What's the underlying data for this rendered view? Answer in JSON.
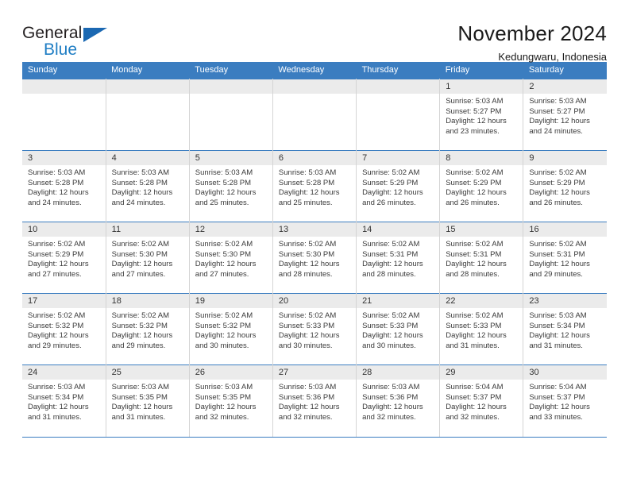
{
  "logo": {
    "word1": "General",
    "word2": "Blue",
    "triangle_color": "#1b68b2",
    "text_color": "#231f20",
    "blue_color": "#1f7ec4"
  },
  "header": {
    "title": "November 2024",
    "location": "Kedungwaru, Indonesia"
  },
  "theme": {
    "header_blue": "#3b7dc0",
    "daynum_band": "#ebebeb",
    "grid_line": "#d4d4d4"
  },
  "day_headers": [
    "Sunday",
    "Monday",
    "Tuesday",
    "Wednesday",
    "Thursday",
    "Friday",
    "Saturday"
  ],
  "weeks": [
    [
      {
        "day": "",
        "empty": true
      },
      {
        "day": "",
        "empty": true
      },
      {
        "day": "",
        "empty": true
      },
      {
        "day": "",
        "empty": true
      },
      {
        "day": "",
        "empty": true
      },
      {
        "day": "1",
        "sunrise": "Sunrise: 5:03 AM",
        "sunset": "Sunset: 5:27 PM",
        "daylight1": "Daylight: 12 hours",
        "daylight2": "and 23 minutes."
      },
      {
        "day": "2",
        "sunrise": "Sunrise: 5:03 AM",
        "sunset": "Sunset: 5:27 PM",
        "daylight1": "Daylight: 12 hours",
        "daylight2": "and 24 minutes."
      }
    ],
    [
      {
        "day": "3",
        "sunrise": "Sunrise: 5:03 AM",
        "sunset": "Sunset: 5:28 PM",
        "daylight1": "Daylight: 12 hours",
        "daylight2": "and 24 minutes."
      },
      {
        "day": "4",
        "sunrise": "Sunrise: 5:03 AM",
        "sunset": "Sunset: 5:28 PM",
        "daylight1": "Daylight: 12 hours",
        "daylight2": "and 24 minutes."
      },
      {
        "day": "5",
        "sunrise": "Sunrise: 5:03 AM",
        "sunset": "Sunset: 5:28 PM",
        "daylight1": "Daylight: 12 hours",
        "daylight2": "and 25 minutes."
      },
      {
        "day": "6",
        "sunrise": "Sunrise: 5:03 AM",
        "sunset": "Sunset: 5:28 PM",
        "daylight1": "Daylight: 12 hours",
        "daylight2": "and 25 minutes."
      },
      {
        "day": "7",
        "sunrise": "Sunrise: 5:02 AM",
        "sunset": "Sunset: 5:29 PM",
        "daylight1": "Daylight: 12 hours",
        "daylight2": "and 26 minutes."
      },
      {
        "day": "8",
        "sunrise": "Sunrise: 5:02 AM",
        "sunset": "Sunset: 5:29 PM",
        "daylight1": "Daylight: 12 hours",
        "daylight2": "and 26 minutes."
      },
      {
        "day": "9",
        "sunrise": "Sunrise: 5:02 AM",
        "sunset": "Sunset: 5:29 PM",
        "daylight1": "Daylight: 12 hours",
        "daylight2": "and 26 minutes."
      }
    ],
    [
      {
        "day": "10",
        "sunrise": "Sunrise: 5:02 AM",
        "sunset": "Sunset: 5:29 PM",
        "daylight1": "Daylight: 12 hours",
        "daylight2": "and 27 minutes."
      },
      {
        "day": "11",
        "sunrise": "Sunrise: 5:02 AM",
        "sunset": "Sunset: 5:30 PM",
        "daylight1": "Daylight: 12 hours",
        "daylight2": "and 27 minutes."
      },
      {
        "day": "12",
        "sunrise": "Sunrise: 5:02 AM",
        "sunset": "Sunset: 5:30 PM",
        "daylight1": "Daylight: 12 hours",
        "daylight2": "and 27 minutes."
      },
      {
        "day": "13",
        "sunrise": "Sunrise: 5:02 AM",
        "sunset": "Sunset: 5:30 PM",
        "daylight1": "Daylight: 12 hours",
        "daylight2": "and 28 minutes."
      },
      {
        "day": "14",
        "sunrise": "Sunrise: 5:02 AM",
        "sunset": "Sunset: 5:31 PM",
        "daylight1": "Daylight: 12 hours",
        "daylight2": "and 28 minutes."
      },
      {
        "day": "15",
        "sunrise": "Sunrise: 5:02 AM",
        "sunset": "Sunset: 5:31 PM",
        "daylight1": "Daylight: 12 hours",
        "daylight2": "and 28 minutes."
      },
      {
        "day": "16",
        "sunrise": "Sunrise: 5:02 AM",
        "sunset": "Sunset: 5:31 PM",
        "daylight1": "Daylight: 12 hours",
        "daylight2": "and 29 minutes."
      }
    ],
    [
      {
        "day": "17",
        "sunrise": "Sunrise: 5:02 AM",
        "sunset": "Sunset: 5:32 PM",
        "daylight1": "Daylight: 12 hours",
        "daylight2": "and 29 minutes."
      },
      {
        "day": "18",
        "sunrise": "Sunrise: 5:02 AM",
        "sunset": "Sunset: 5:32 PM",
        "daylight1": "Daylight: 12 hours",
        "daylight2": "and 29 minutes."
      },
      {
        "day": "19",
        "sunrise": "Sunrise: 5:02 AM",
        "sunset": "Sunset: 5:32 PM",
        "daylight1": "Daylight: 12 hours",
        "daylight2": "and 30 minutes."
      },
      {
        "day": "20",
        "sunrise": "Sunrise: 5:02 AM",
        "sunset": "Sunset: 5:33 PM",
        "daylight1": "Daylight: 12 hours",
        "daylight2": "and 30 minutes."
      },
      {
        "day": "21",
        "sunrise": "Sunrise: 5:02 AM",
        "sunset": "Sunset: 5:33 PM",
        "daylight1": "Daylight: 12 hours",
        "daylight2": "and 30 minutes."
      },
      {
        "day": "22",
        "sunrise": "Sunrise: 5:02 AM",
        "sunset": "Sunset: 5:33 PM",
        "daylight1": "Daylight: 12 hours",
        "daylight2": "and 31 minutes."
      },
      {
        "day": "23",
        "sunrise": "Sunrise: 5:03 AM",
        "sunset": "Sunset: 5:34 PM",
        "daylight1": "Daylight: 12 hours",
        "daylight2": "and 31 minutes."
      }
    ],
    [
      {
        "day": "24",
        "sunrise": "Sunrise: 5:03 AM",
        "sunset": "Sunset: 5:34 PM",
        "daylight1": "Daylight: 12 hours",
        "daylight2": "and 31 minutes."
      },
      {
        "day": "25",
        "sunrise": "Sunrise: 5:03 AM",
        "sunset": "Sunset: 5:35 PM",
        "daylight1": "Daylight: 12 hours",
        "daylight2": "and 31 minutes."
      },
      {
        "day": "26",
        "sunrise": "Sunrise: 5:03 AM",
        "sunset": "Sunset: 5:35 PM",
        "daylight1": "Daylight: 12 hours",
        "daylight2": "and 32 minutes."
      },
      {
        "day": "27",
        "sunrise": "Sunrise: 5:03 AM",
        "sunset": "Sunset: 5:36 PM",
        "daylight1": "Daylight: 12 hours",
        "daylight2": "and 32 minutes."
      },
      {
        "day": "28",
        "sunrise": "Sunrise: 5:03 AM",
        "sunset": "Sunset: 5:36 PM",
        "daylight1": "Daylight: 12 hours",
        "daylight2": "and 32 minutes."
      },
      {
        "day": "29",
        "sunrise": "Sunrise: 5:04 AM",
        "sunset": "Sunset: 5:37 PM",
        "daylight1": "Daylight: 12 hours",
        "daylight2": "and 32 minutes."
      },
      {
        "day": "30",
        "sunrise": "Sunrise: 5:04 AM",
        "sunset": "Sunset: 5:37 PM",
        "daylight1": "Daylight: 12 hours",
        "daylight2": "and 33 minutes."
      }
    ]
  ]
}
